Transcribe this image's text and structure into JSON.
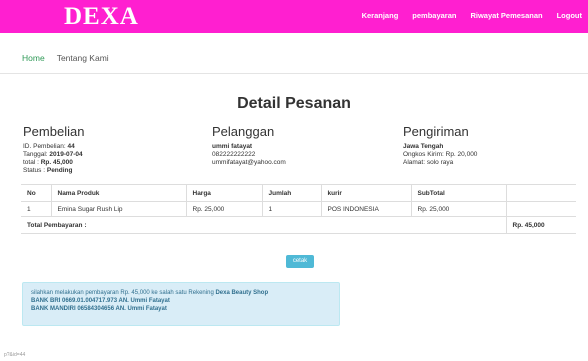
{
  "brand": {
    "name": "DEXA"
  },
  "nav": {
    "items": [
      "Keranjang",
      "pembayaran",
      "Riwayat Pemesanan",
      "Logout"
    ]
  },
  "subnav": {
    "home": "Home",
    "about": "Tentang Kami"
  },
  "page": {
    "title": "Detail Pesanan"
  },
  "pembelian": {
    "heading": "Pembelian",
    "id_label": "ID. Pembelian:",
    "id_value": "44",
    "tanggal_label": "Tanggal:",
    "tanggal_value": "2019-07-04",
    "total_label": "total :",
    "total_value": "Rp. 45,000",
    "status_label": "Status :",
    "status_value": "Pending"
  },
  "pelanggan": {
    "heading": "Pelanggan",
    "name": "ummi fatayat",
    "phone": "082222222222",
    "email": "ummifatayat@yahoo.com"
  },
  "pengiriman": {
    "heading": "Pengiriman",
    "province": "Jawa Tengah",
    "ongkos": "Ongkos Kirim: Rp. 20,000",
    "alamat": "Alamat: solo raya"
  },
  "table": {
    "headers": [
      "No",
      "Nama Produk",
      "Harga",
      "Jumlah",
      "kurir",
      "SubTotal"
    ],
    "rows": [
      [
        "1",
        "Emina Sugar Rush Lip",
        "Rp. 25,000",
        "1",
        "POS INDONESIA",
        "Rp. 25,000"
      ]
    ],
    "total_label": "Total Pembayaran :",
    "total_value": "Rp. 45,000"
  },
  "cetak_label": "cetak",
  "info": {
    "line1_prefix": "silahkan melakukan pembayaran Rp. 45,000 ke salah satu Rekening",
    "line1_shop": "Dexa Beauty Shop",
    "line2": "BANK BRI 0669.01.004717.973 AN. Ummi Fatayat",
    "line3": "BANK MANDIRI 06584304656 AN. Ummi Fatayat"
  },
  "footer_note": "p?&id=44"
}
